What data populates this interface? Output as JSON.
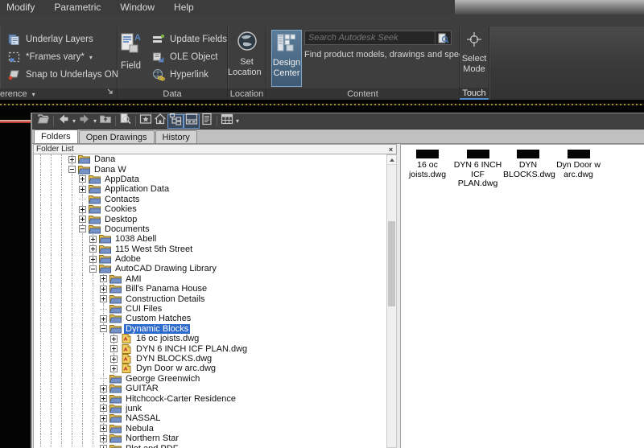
{
  "menubar": {
    "items": [
      "Modify",
      "Parametric",
      "Window",
      "Help"
    ]
  },
  "ribbon": {
    "reference_panel": {
      "label": "erence",
      "rows": [
        {
          "label": "Underlay Layers",
          "icon": "underlay-layers-icon",
          "caret": false
        },
        {
          "label": "*Frames vary*",
          "icon": "frames-vary-icon",
          "caret": true
        },
        {
          "label": "Snap to Underlays ON",
          "icon": "snap-underlays-icon",
          "caret": true
        }
      ]
    },
    "data_panel": {
      "label": "Data",
      "big_button_label": "Field",
      "rows": [
        {
          "label": "Update Fields",
          "icon": "update-fields-icon",
          "caret": false
        },
        {
          "label": "OLE Object",
          "icon": "ole-object-icon",
          "caret": false
        },
        {
          "label": "Hyperlink",
          "icon": "hyperlink-icon",
          "caret": false
        }
      ]
    },
    "location_panel": {
      "label": "Location",
      "button_line1": "Set",
      "button_line2": "Location"
    },
    "content_panel": {
      "label": "Content",
      "design_center_line1": "Design",
      "design_center_line2": "Center",
      "search_placeholder": "Search Autodesk Seek",
      "search_hint": "Find product models, drawings and specs"
    },
    "touch_panel": {
      "label": "Touch",
      "button_line1": "Select",
      "button_line2": "Mode"
    }
  },
  "designcenter": {
    "toolbar_icons": [
      {
        "name": "load-icon",
        "caret": false,
        "pressed": false,
        "sep_after": true
      },
      {
        "name": "back-icon",
        "caret": true,
        "pressed": false,
        "sep_after": false
      },
      {
        "name": "forward-icon",
        "caret": true,
        "pressed": false,
        "sep_after": false
      },
      {
        "name": "up-icon",
        "caret": false,
        "pressed": false,
        "sep_after": true
      },
      {
        "name": "search-icon",
        "caret": false,
        "pressed": false,
        "sep_after": true
      },
      {
        "name": "favorites-icon",
        "caret": false,
        "pressed": false,
        "sep_after": false
      },
      {
        "name": "home-icon",
        "caret": false,
        "pressed": false,
        "sep_after": false
      },
      {
        "name": "tree-view-icon",
        "caret": false,
        "pressed": true,
        "sep_after": false
      },
      {
        "name": "preview-icon",
        "caret": false,
        "pressed": true,
        "sep_after": false
      },
      {
        "name": "description-icon",
        "caret": false,
        "pressed": false,
        "sep_after": true
      },
      {
        "name": "views-icon",
        "caret": true,
        "pressed": false,
        "sep_after": false
      }
    ],
    "tabs": [
      {
        "label": "Folders",
        "active": true
      },
      {
        "label": "Open Drawings",
        "active": false
      },
      {
        "label": "History",
        "active": false
      }
    ],
    "tree_header": "Folder List",
    "tree": [
      {
        "label": "Dana",
        "depth": 3,
        "exp": "plus",
        "type": "folder",
        "selected": false
      },
      {
        "label": "Dana W",
        "depth": 3,
        "exp": "minus",
        "type": "folder",
        "selected": false
      },
      {
        "label": "AppData",
        "depth": 4,
        "exp": "plus",
        "type": "folder",
        "selected": false
      },
      {
        "label": "Application Data",
        "depth": 4,
        "exp": "plus",
        "type": "folder",
        "selected": false
      },
      {
        "label": "Contacts",
        "depth": 4,
        "exp": "none",
        "type": "folder",
        "selected": false
      },
      {
        "label": "Cookies",
        "depth": 4,
        "exp": "plus",
        "type": "folder",
        "selected": false
      },
      {
        "label": "Desktop",
        "depth": 4,
        "exp": "plus",
        "type": "folder",
        "selected": false
      },
      {
        "label": "Documents",
        "depth": 4,
        "exp": "minus",
        "type": "folder",
        "selected": false
      },
      {
        "label": "1038 Abell",
        "depth": 5,
        "exp": "plus",
        "type": "folder",
        "selected": false
      },
      {
        "label": "115 West 5th Street",
        "depth": 5,
        "exp": "plus",
        "type": "folder",
        "selected": false
      },
      {
        "label": "Adobe",
        "depth": 5,
        "exp": "plus",
        "type": "folder",
        "selected": false
      },
      {
        "label": "AutoCAD Drawing Library",
        "depth": 5,
        "exp": "minus",
        "type": "folder",
        "selected": false
      },
      {
        "label": "AMI",
        "depth": 6,
        "exp": "plus",
        "type": "folder",
        "selected": false
      },
      {
        "label": "Bill's Panama House",
        "depth": 6,
        "exp": "plus",
        "type": "folder",
        "selected": false
      },
      {
        "label": "Construction Details",
        "depth": 6,
        "exp": "plus",
        "type": "folder",
        "selected": false
      },
      {
        "label": "CUI Files",
        "depth": 6,
        "exp": "none",
        "type": "folder",
        "selected": false
      },
      {
        "label": "Custom Hatches",
        "depth": 6,
        "exp": "plus",
        "type": "folder",
        "selected": false
      },
      {
        "label": "Dynamic Blocks",
        "depth": 6,
        "exp": "minus",
        "type": "folder",
        "selected": true
      },
      {
        "label": "16 oc joists.dwg",
        "depth": 7,
        "exp": "plus",
        "type": "dwg",
        "selected": false
      },
      {
        "label": "DYN 6 INCH ICF PLAN.dwg",
        "depth": 7,
        "exp": "plus",
        "type": "dwg",
        "selected": false
      },
      {
        "label": "DYN BLOCKS.dwg",
        "depth": 7,
        "exp": "plus",
        "type": "dwg",
        "selected": false
      },
      {
        "label": "Dyn Door w arc.dwg",
        "depth": 7,
        "exp": "plus",
        "type": "dwg",
        "selected": false
      },
      {
        "label": "George Greenwich",
        "depth": 6,
        "exp": "none",
        "type": "folder",
        "selected": false
      },
      {
        "label": "GUITAR",
        "depth": 6,
        "exp": "plus",
        "type": "folder",
        "selected": false
      },
      {
        "label": "Hitchcock-Carter Residence",
        "depth": 6,
        "exp": "plus",
        "type": "folder",
        "selected": false
      },
      {
        "label": "junk",
        "depth": 6,
        "exp": "plus",
        "type": "folder",
        "selected": false
      },
      {
        "label": "NASSAL",
        "depth": 6,
        "exp": "plus",
        "type": "folder",
        "selected": false
      },
      {
        "label": "Nebula",
        "depth": 6,
        "exp": "plus",
        "type": "folder",
        "selected": false
      },
      {
        "label": "Northern Star",
        "depth": 6,
        "exp": "plus",
        "type": "folder",
        "selected": false
      },
      {
        "label": "Plot and PDF",
        "depth": 6,
        "exp": "plus",
        "type": "folder",
        "selected": false
      }
    ],
    "content_items": [
      {
        "line1": "16 oc",
        "line2": "joists.dwg"
      },
      {
        "line1": "DYN 6 INCH",
        "line2": "ICF PLAN.dwg"
      },
      {
        "line1": "DYN",
        "line2": "BLOCKS.dwg"
      },
      {
        "line1": "Dyn Door w",
        "line2": "arc.dwg"
      }
    ]
  },
  "colors": {
    "selection_blue": "#2e6bcd",
    "ribbon_bg": "#3e3e3e",
    "accent_blue": "#4f8fd0",
    "canvas_red": "#c03a2d",
    "dash_yellow": "#9f8d35"
  }
}
